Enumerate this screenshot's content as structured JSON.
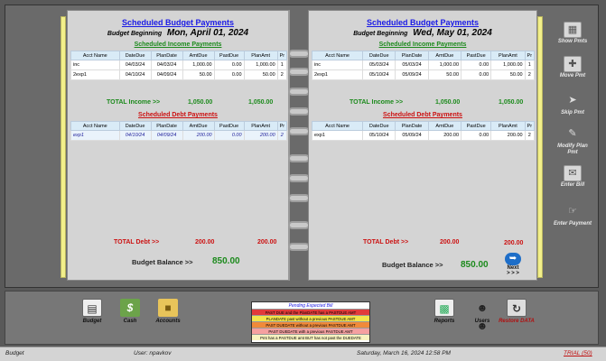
{
  "left": {
    "title": "Scheduled Budget Payments",
    "budget_beginning_label": "Budget Beginning",
    "budget_beginning_date": "Mon, April 01, 2024",
    "income_title": "Scheduled Income Payments",
    "income_headers": [
      "Acct Name",
      "DateDue",
      "PlanDate",
      "AmtDue",
      "PastDue",
      "PlanAmt",
      "Pr"
    ],
    "income_rows": [
      [
        "inc",
        "04/03/24",
        "04/03/24",
        "1,000.00",
        "0.00",
        "1,000.00",
        "1"
      ],
      [
        "2exp1",
        "04/10/24",
        "04/09/24",
        "50.00",
        "0.00",
        "50.00",
        "2"
      ]
    ],
    "total_income_label": "TOTAL Income >>",
    "total_income_a": "1,050.00",
    "total_income_b": "1,050.00",
    "debt_title": "Scheduled Debt Payments",
    "debt_headers": [
      "Acct Name",
      "DateDue",
      "PlanDate",
      "AmtDue",
      "PastDue",
      "PlanAmt",
      "Pr"
    ],
    "debt_rows": [
      [
        "exp1",
        "04/10/24",
        "04/09/24",
        "200.00",
        "0.00",
        "200.00",
        "2"
      ]
    ],
    "total_debt_label": "TOTAL Debt >>",
    "total_debt_a": "200.00",
    "total_debt_b": "200.00",
    "balance_label": "Budget Balance >>",
    "balance_value": "850.00"
  },
  "right": {
    "title": "Scheduled Budget Payments",
    "budget_beginning_label": "Budget Beginning",
    "budget_beginning_date": "Wed, May 01, 2024",
    "income_title": "Scheduled Income Payments",
    "income_headers": [
      "Acct Name",
      "DateDue",
      "PlanDate",
      "AmtDue",
      "PastDue",
      "PlanAmt",
      "Pr"
    ],
    "income_rows": [
      [
        "inc",
        "05/03/24",
        "05/03/24",
        "1,000.00",
        "0.00",
        "1,000.00",
        "1"
      ],
      [
        "2exp1",
        "05/10/24",
        "05/09/24",
        "50.00",
        "0.00",
        "50.00",
        "2"
      ]
    ],
    "total_income_label": "TOTAL Income >>",
    "total_income_a": "1,050.00",
    "total_income_b": "1,050.00",
    "debt_title": "Scheduled Debt Payments",
    "debt_headers": [
      "Acct Name",
      "DateDue",
      "PlanDate",
      "AmtDue",
      "PastDue",
      "PlanAmt",
      "Pr"
    ],
    "debt_rows": [
      [
        "exp1",
        "05/10/24",
        "05/09/24",
        "200.00",
        "0.00",
        "200.00",
        "2"
      ]
    ],
    "total_debt_label": "TOTAL Debt >>",
    "total_debt_a": "200.00",
    "total_debt_b": "200.00",
    "balance_label": "Budget Balance >>",
    "balance_value": "850.00",
    "next_label": "Next",
    "next_arrows": "> > >"
  },
  "side_buttons": [
    {
      "label": "Show Pmts",
      "icon": "grid-icon"
    },
    {
      "label": "Move Pmt",
      "icon": "move-icon"
    },
    {
      "label": "Skip Pmt",
      "icon": "skip-icon"
    },
    {
      "label": "Modify Plan Pmt",
      "icon": "pencil-icon"
    },
    {
      "label": "Enter Bill",
      "icon": "bill-icon"
    },
    {
      "label": "Enter Payment",
      "icon": "payment-icon"
    }
  ],
  "bottom_buttons": {
    "budget": "Budget",
    "cash": "Cash",
    "accounts": "Accounts",
    "reports": "Reports",
    "users": "Users",
    "restore": "Restore DATA"
  },
  "legend": {
    "header": "Pending Expected Bill",
    "rows": [
      {
        "text": "PAST DUE and the PlanDATE has a PASTDUE AMT",
        "color": "#e23b3b"
      },
      {
        "text": "PLANDATE past without a previous PASTDUE AMT",
        "color": "#f3e54a"
      },
      {
        "text": "PAST DUEDATE without a previous PASTDUE AMT",
        "color": "#f08a3a"
      },
      {
        "text": "PAST DUEDATE with a previous PASTDUE AMT",
        "color": "#f5a0a0"
      },
      {
        "text": "Pmt has a PASTDUE amt BUT has not past the DUEDATE",
        "color": "#f8f3c0"
      }
    ]
  },
  "status": {
    "mode": "Budget",
    "user": "User: npavkov",
    "datetime": "Saturday, March 16, 2024    12:58 PM",
    "trial": "TRIAL (50)"
  }
}
